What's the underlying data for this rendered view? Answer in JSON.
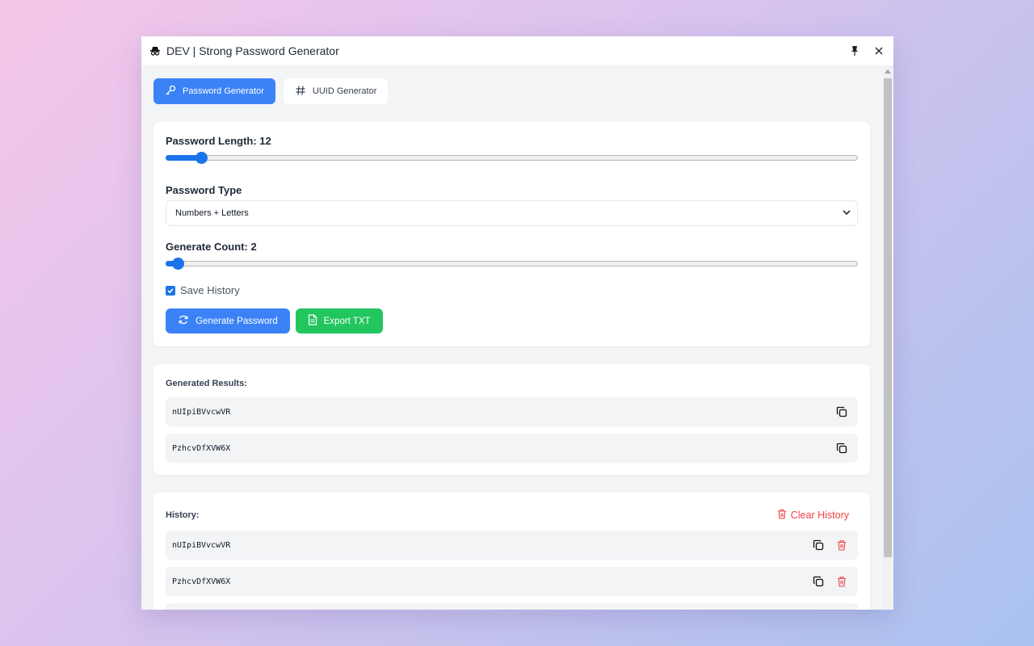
{
  "window": {
    "title": "DEV | Strong Password Generator",
    "app_icon": "spy-icon"
  },
  "tabs": [
    {
      "label": "Password Generator",
      "icon": "key-icon",
      "active": true
    },
    {
      "label": "UUID Generator",
      "icon": "hash-icon",
      "active": false
    }
  ],
  "settings": {
    "length_label": "Password Length: 12",
    "length_value": 12,
    "type_label": "Password Type",
    "type_selected": "Numbers + Letters",
    "count_label": "Generate Count: 2",
    "count_value": 2,
    "save_history_label": "Save History",
    "save_history_checked": true,
    "generate_button": "Generate Password",
    "export_button": "Export TXT"
  },
  "results": {
    "header": "Generated Results:",
    "items": [
      "nUIpiBVvcwVR",
      "PzhcvDfXVW6X"
    ]
  },
  "history": {
    "header": "History:",
    "clear_label": "Clear History",
    "items": [
      "nUIpiBVvcwVR",
      "PzhcvDfXVW6X"
    ]
  },
  "colors": {
    "accent": "#3b82f6",
    "success": "#22c55e",
    "danger": "#ef4444"
  }
}
